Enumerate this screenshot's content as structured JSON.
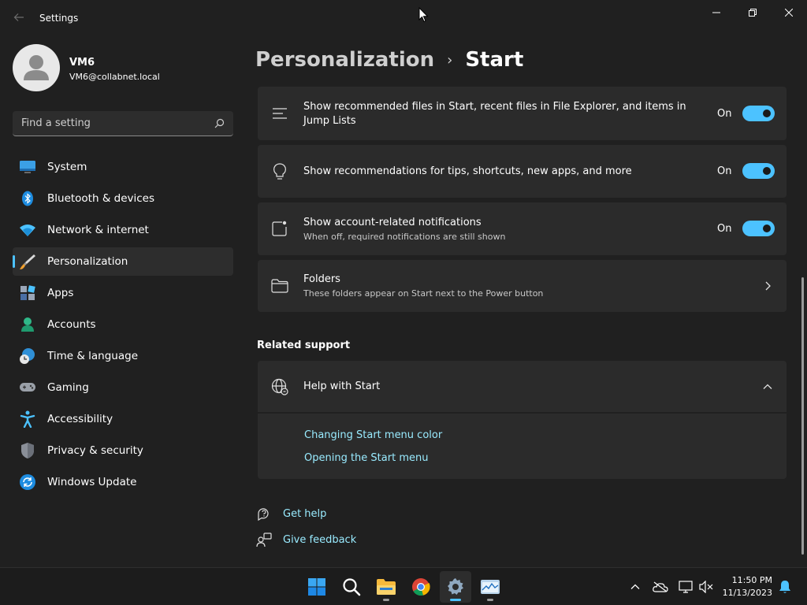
{
  "window": {
    "app_title": "Settings",
    "back_icon": "back-arrow-icon",
    "controls": [
      "minimize-icon",
      "maximize-icon",
      "close-icon"
    ]
  },
  "profile": {
    "name": "VM6",
    "email": "VM6@collabnet.local"
  },
  "search": {
    "placeholder": "Find a setting"
  },
  "sidebar": {
    "items": [
      {
        "label": "System",
        "icon": "system-icon"
      },
      {
        "label": "Bluetooth & devices",
        "icon": "bluetooth-icon"
      },
      {
        "label": "Network & internet",
        "icon": "wifi-icon"
      },
      {
        "label": "Personalization",
        "icon": "brush-icon",
        "active": true
      },
      {
        "label": "Apps",
        "icon": "apps-icon"
      },
      {
        "label": "Accounts",
        "icon": "accounts-icon"
      },
      {
        "label": "Time & language",
        "icon": "globe-clock-icon"
      },
      {
        "label": "Gaming",
        "icon": "gamepad-icon"
      },
      {
        "label": "Accessibility",
        "icon": "accessibility-icon"
      },
      {
        "label": "Privacy & security",
        "icon": "shield-icon"
      },
      {
        "label": "Windows Update",
        "icon": "update-icon"
      }
    ]
  },
  "breadcrumb": {
    "parent": "Personalization",
    "separator": "›",
    "current": "Start"
  },
  "settings": {
    "recommended_files": {
      "title": "Show recommended files in Start, recent files in File Explorer, and items in Jump Lists",
      "state": "On",
      "enabled": true
    },
    "recommendations": {
      "title": "Show recommendations for tips, shortcuts, new apps, and more",
      "state": "On",
      "enabled": true
    },
    "account_notifications": {
      "title": "Show account-related notifications",
      "description": "When off, required notifications are still shown",
      "state": "On",
      "enabled": true
    },
    "folders": {
      "title": "Folders",
      "description": "These folders appear on Start next to the Power button"
    }
  },
  "related_support": {
    "heading": "Related support",
    "help": {
      "title": "Help with Start",
      "expanded": true,
      "links": [
        "Changing Start menu color",
        "Opening the Start menu"
      ]
    }
  },
  "footer": {
    "get_help": "Get help",
    "give_feedback": "Give feedback"
  },
  "taskbar": {
    "apps": [
      "start-icon",
      "search-icon",
      "file-explorer-icon",
      "chrome-icon",
      "settings-icon",
      "task-manager-icon"
    ],
    "tray": [
      "chevron-up-icon",
      "onedrive-icon",
      "network-icon",
      "volume-muted-icon",
      "notification-bell-icon"
    ],
    "time": "11:50 PM",
    "date": "11/13/2023"
  },
  "colors": {
    "accent": "#4cc2ff",
    "link": "#99ebff",
    "background": "#202020",
    "card": "#2b2b2b"
  }
}
